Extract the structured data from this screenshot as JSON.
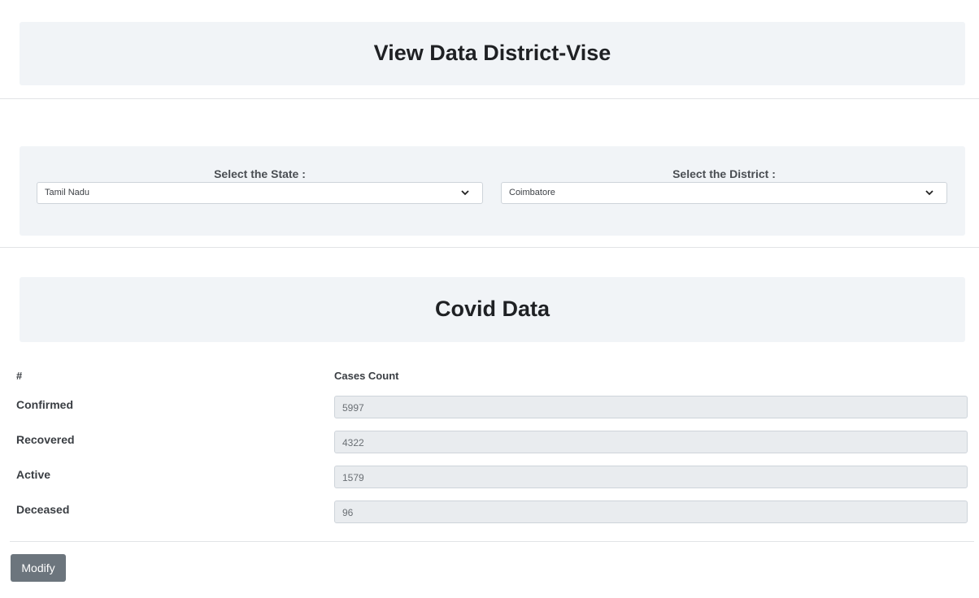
{
  "header": {
    "title": "View Data District-Vise"
  },
  "filters": {
    "state": {
      "label": "Select the State :",
      "selected": "Tamil Nadu"
    },
    "district": {
      "label": "Select the District :",
      "selected": "Coimbatore"
    }
  },
  "covid": {
    "title": "Covid Data",
    "table": {
      "headers": [
        "#",
        "Cases Count"
      ],
      "rows": [
        {
          "label": "Confirmed",
          "value": "5997"
        },
        {
          "label": "Recovered",
          "value": "4322"
        },
        {
          "label": "Active",
          "value": "1579"
        },
        {
          "label": "Deceased",
          "value": "96"
        }
      ]
    }
  },
  "actions": {
    "modify_label": "Modify"
  },
  "icons": {
    "dropdown": "chevron-down-icon"
  },
  "colors": {
    "panel_bg": "#f1f4f7",
    "button_bg": "#6c757d",
    "readonly_field_bg": "#e9ecef"
  }
}
